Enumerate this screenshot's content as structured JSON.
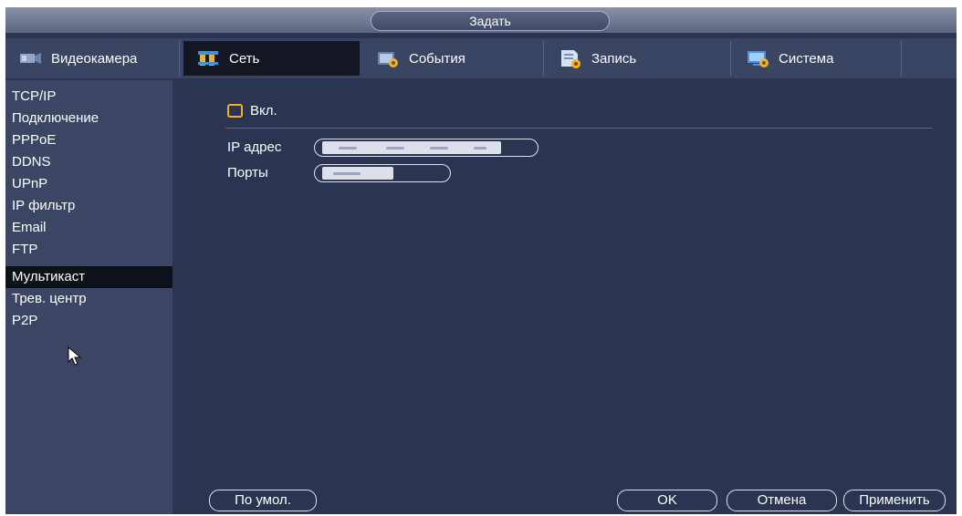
{
  "title": "Задать",
  "tabs": [
    {
      "label": "Видеокамера",
      "icon": "camera-icon"
    },
    {
      "label": "Сеть",
      "icon": "network-icon"
    },
    {
      "label": "События",
      "icon": "events-icon"
    },
    {
      "label": "Запись",
      "icon": "record-icon"
    },
    {
      "label": "Система",
      "icon": "system-icon"
    }
  ],
  "sidebar": {
    "items": [
      {
        "label": "TCP/IP"
      },
      {
        "label": "Подключение"
      },
      {
        "label": "PPPoE"
      },
      {
        "label": "DDNS"
      },
      {
        "label": "UPnP"
      },
      {
        "label": "IP фильтр"
      },
      {
        "label": "Email"
      },
      {
        "label": "FTP"
      },
      {
        "label": "Мультикаст"
      },
      {
        "label": "Трев. центр"
      },
      {
        "label": "P2P"
      }
    ],
    "active_index": 8
  },
  "main": {
    "enable_label": "Вкл.",
    "ip_label": "IP адрес",
    "ports_label": "Порты"
  },
  "buttons": {
    "default": "По умол.",
    "ok": "OK",
    "cancel": "Отмена",
    "apply": "Применить"
  },
  "colors": {
    "background": "#2b3552",
    "sidebar": "#3c4664",
    "active": "#0d121a",
    "checkbox_accent": "#f2b11c"
  }
}
